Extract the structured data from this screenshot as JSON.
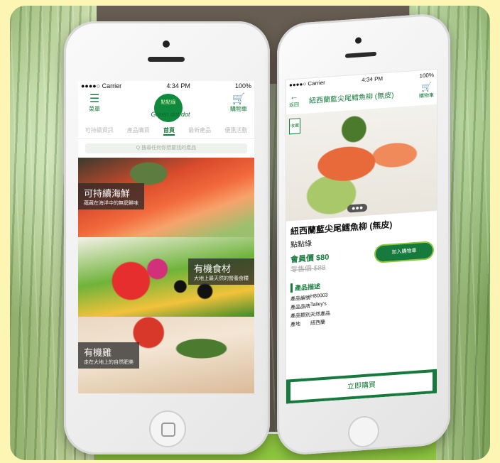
{
  "phone_left": {
    "status_bar": {
      "carrier": "●●●●○ Carrier",
      "time": "4:34 PM",
      "battery": "100%"
    },
    "header": {
      "menu_label": "菜單",
      "logo_text": "點點綠",
      "logo_sub": "Green dot dot",
      "cart_label": "購物車"
    },
    "tabs": [
      "可持續資訊",
      "產品購買",
      "首頁",
      "最新產品",
      "優惠活動"
    ],
    "active_tab": "首頁",
    "search_placeholder": "Q 搜尋任何你想要找的產品",
    "banners": [
      {
        "title": "可持續海鮮",
        "subtitle": "蘊藏在海洋中的無窮鮮味"
      },
      {
        "title": "有機食材",
        "subtitle": "大地上最天然的營養食糧"
      },
      {
        "title": "有機雞",
        "subtitle": "走在大地上的自然肥美"
      }
    ]
  },
  "phone_right": {
    "status_bar": {
      "carrier": "●●●●○ Carrier",
      "time": "4:34 PM",
      "battery": "100%"
    },
    "header": {
      "back_label": "返回",
      "title": "紐西蘭藍尖尾鱈魚柳 (無皮)",
      "cart_label": "購物車"
    },
    "bookmark_label": "收藏",
    "carousel_indicator": "●●●",
    "product": {
      "name": "紐西蘭藍尖尾鱈魚柳 (無皮)",
      "brand": "點點綠",
      "member_price": "會員價 $80",
      "retail_price": "零售價 $88",
      "add_to_cart": "加入購物車"
    },
    "description_heading": "產品描述",
    "details": [
      {
        "key": "產品編號",
        "value": "H80003"
      },
      {
        "key": "產品品牌",
        "value": "Talley's"
      },
      {
        "key": "產品類別",
        "value": "天然產品"
      },
      {
        "key": "產地",
        "value": "紐西蘭"
      }
    ],
    "buy_now": "立即購買"
  },
  "colors": {
    "brand_green": "#157a3c",
    "accent_lime": "#8dc63f",
    "frame_yellow": "#fdf5b4"
  }
}
